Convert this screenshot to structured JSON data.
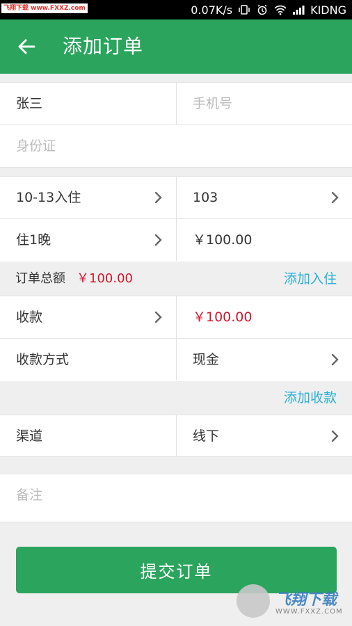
{
  "status_bar": {
    "watermark": "飞翔下载 www.FXXZ.com",
    "speed": "0.07K/s",
    "carrier": "KIDNG"
  },
  "app_bar": {
    "title": "添加订单"
  },
  "guest": {
    "name_value": "张三",
    "phone_placeholder": "手机号",
    "id_placeholder": "身份证"
  },
  "booking": {
    "checkin": "10-13入住",
    "room": "103",
    "nights": "住1晚",
    "price": "￥100.00"
  },
  "summary": {
    "label": "订单总额",
    "amount": "￥100.00",
    "add_checkin": "添加入住"
  },
  "payment": {
    "label": "收款",
    "amount": "￥100.00",
    "method_label": "收款方式",
    "method_value": "现金",
    "add_payment": "添加收款"
  },
  "channel": {
    "label": "渠道",
    "value": "线下"
  },
  "remark": {
    "placeholder": "备注"
  },
  "submit_label": "提交订单",
  "logo": {
    "name": "飞翔下载",
    "url": "WWW.FXXZ.COM"
  },
  "colors": {
    "brand_green": "#2ba55d",
    "price_red": "#d0162d",
    "link_blue": "#2bb0d6"
  }
}
